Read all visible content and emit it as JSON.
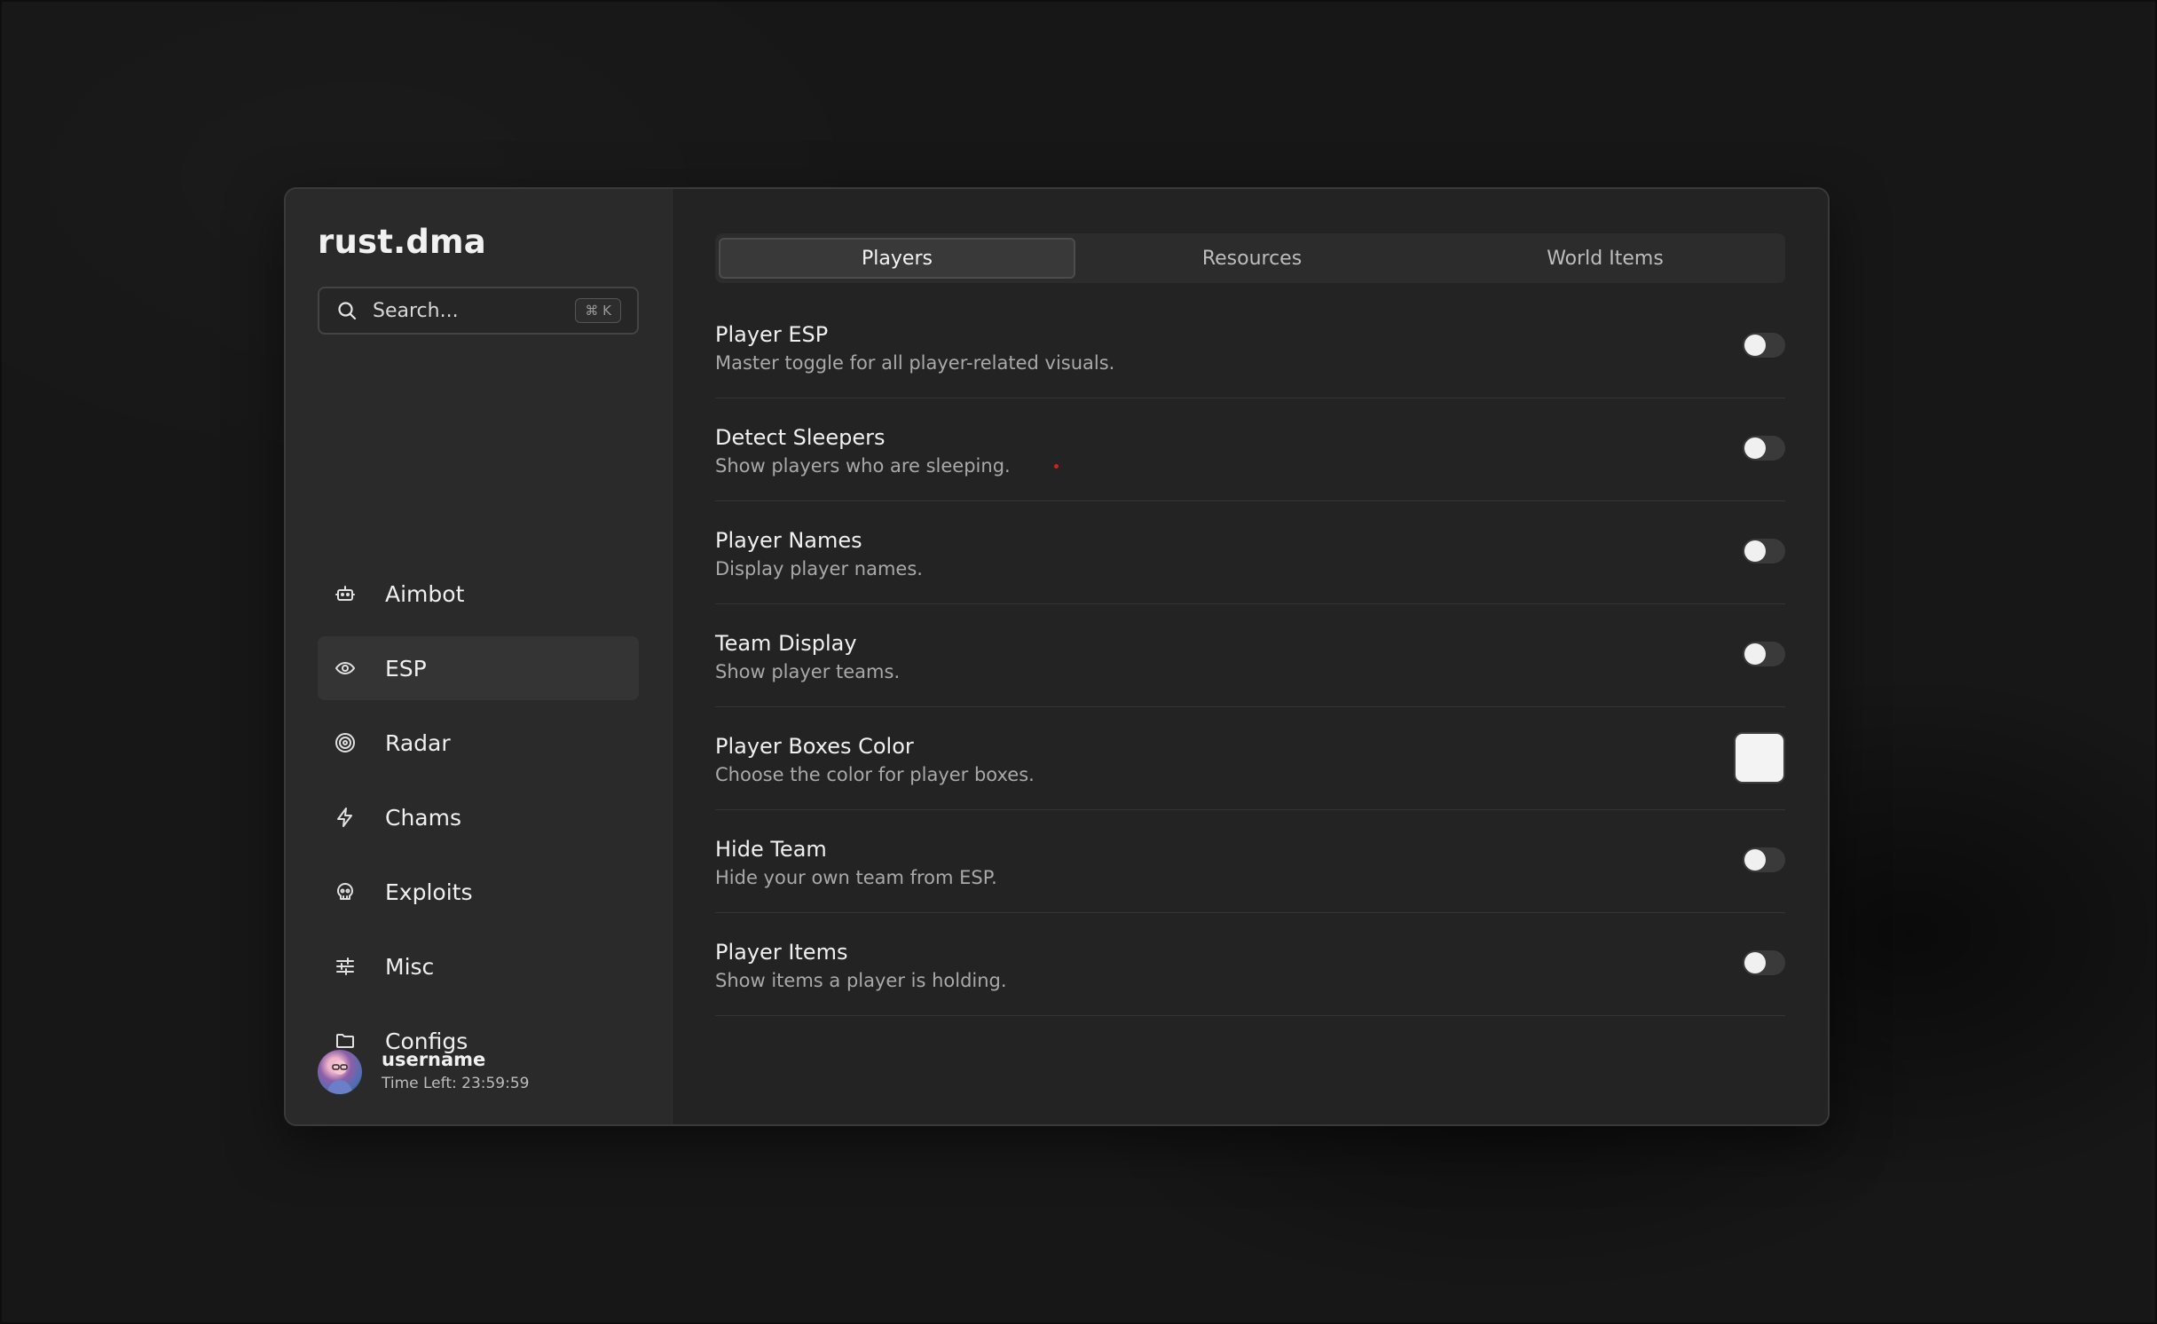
{
  "app": {
    "title": "rust.dma"
  },
  "search": {
    "placeholder": "Search...",
    "shortcut": "⌘ K"
  },
  "sidebar": {
    "items": [
      {
        "label": "Aimbot",
        "icon": "bot-icon",
        "active": false
      },
      {
        "label": "ESP",
        "icon": "eye-icon",
        "active": true
      },
      {
        "label": "Radar",
        "icon": "radar-icon",
        "active": false
      },
      {
        "label": "Chams",
        "icon": "lightning-icon",
        "active": false
      },
      {
        "label": "Exploits",
        "icon": "skull-icon",
        "active": false
      },
      {
        "label": "Misc",
        "icon": "sliders-icon",
        "active": false
      },
      {
        "label": "Configs",
        "icon": "folder-icon",
        "active": false
      }
    ]
  },
  "user": {
    "name": "username",
    "time_left": "Time Left: 23:59:59"
  },
  "tabs": [
    {
      "label": "Players",
      "active": true
    },
    {
      "label": "Resources",
      "active": false
    },
    {
      "label": "World Items",
      "active": false
    }
  ],
  "settings": [
    {
      "title": "Player ESP",
      "description": "Master toggle for all player-related visuals.",
      "control": "toggle",
      "enabled": false
    },
    {
      "title": "Detect Sleepers",
      "description": "Show players who are sleeping.",
      "control": "toggle",
      "enabled": false
    },
    {
      "title": "Player Names",
      "description": "Display player names.",
      "control": "toggle",
      "enabled": false
    },
    {
      "title": "Team Display",
      "description": "Show player teams.",
      "control": "toggle",
      "enabled": false
    },
    {
      "title": "Player Boxes Color",
      "description": "Choose the color for player boxes.",
      "control": "color",
      "color": "#f3f3f3"
    },
    {
      "title": "Hide Team",
      "description": "Hide your own team from ESP.",
      "control": "toggle",
      "enabled": false
    },
    {
      "title": "Player Items",
      "description": "Show items a player is holding.",
      "control": "toggle",
      "enabled": false
    }
  ],
  "colors": {
    "background": "#171717",
    "window": "#222222",
    "sidebar": "#2a2a2a",
    "accent_dot": "#d12020"
  }
}
